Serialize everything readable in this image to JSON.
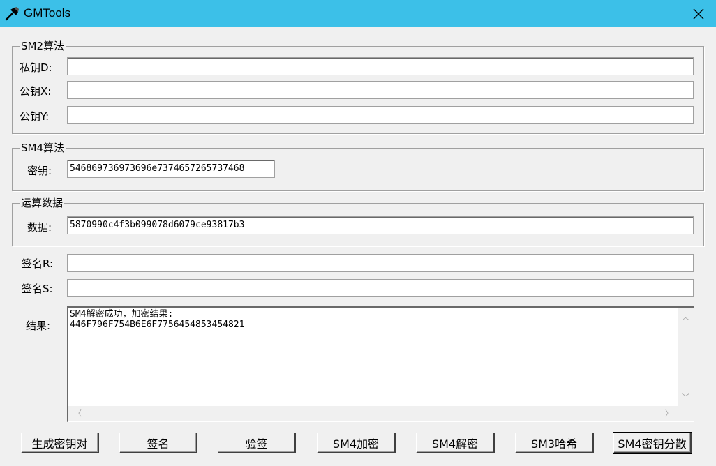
{
  "window": {
    "title": "GMTools"
  },
  "sm2": {
    "legend": "SM2算法",
    "private_key_label": "私钥D:",
    "private_key_value": "",
    "public_x_label": "公钥X:",
    "public_x_value": "",
    "public_y_label": "公钥Y:",
    "public_y_value": ""
  },
  "sm4": {
    "legend": "SM4算法",
    "key_label": "密钥:",
    "key_value": "546869736973696e7374657265737468"
  },
  "data": {
    "legend": "运算数据",
    "data_label": "数据:",
    "data_value": "5870990c4f3b099078d6079ce93817b3"
  },
  "signature": {
    "r_label": "签名R:",
    "r_value": "",
    "s_label": "签名S:",
    "s_value": ""
  },
  "result": {
    "label": "结果:",
    "text": "SM4解密成功，加密结果:\n446F796F754B6E6F7756454853454821"
  },
  "buttons": {
    "gen_keypair": "生成密钥对",
    "sign": "签名",
    "verify": "验签",
    "sm4_encrypt": "SM4加密",
    "sm4_decrypt": "SM4解密",
    "sm3_hash": "SM3哈希",
    "sm4_key_disperse": "SM4密钥分散"
  },
  "icons": {
    "app": "hammer-icon",
    "close": "close-icon"
  },
  "colors": {
    "titlebar": "#3cc0e8",
    "window_bg": "#f0f0f0"
  }
}
